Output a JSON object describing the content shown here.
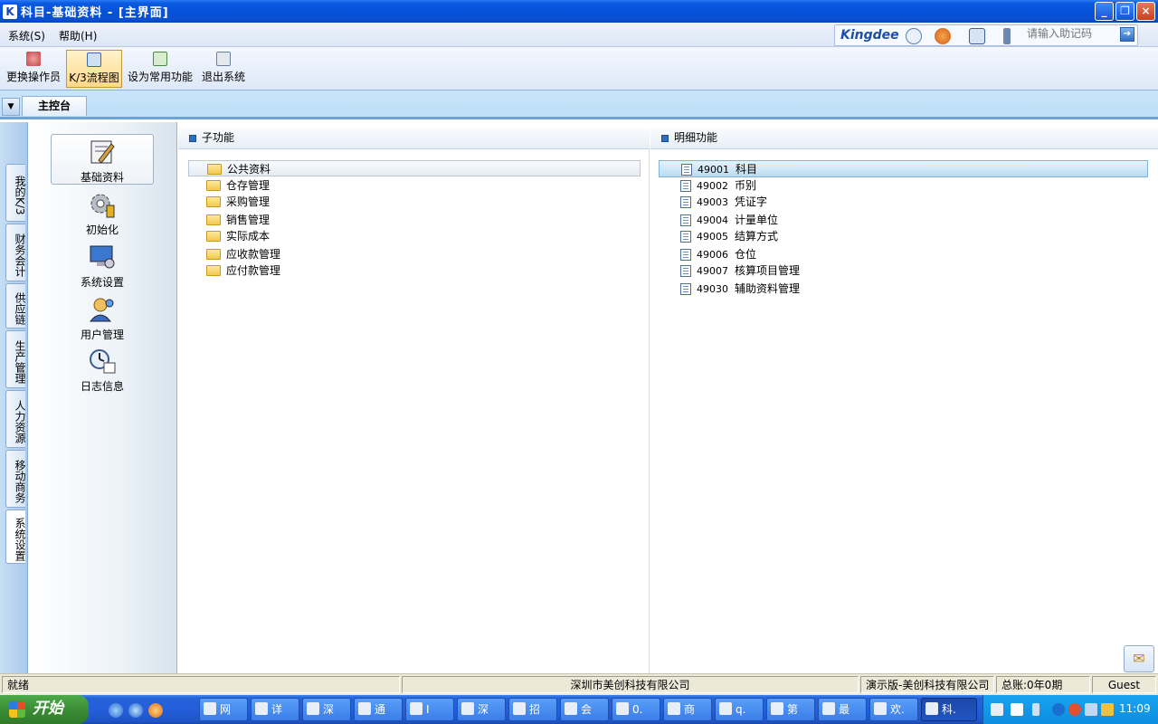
{
  "window": {
    "app_icon": "K",
    "title": "科目-基础资料 - [主界面]",
    "buttons": [
      "_",
      "❐",
      "×"
    ]
  },
  "menu": {
    "items": [
      "系统(S)",
      "帮助(H)"
    ],
    "brand": "Kingdee",
    "help_placeholder": "请输入助记码",
    "go_label": "➔"
  },
  "toolbar": {
    "buttons": [
      "更换操作员",
      "K/3流程图",
      "设为常用功能",
      "退出系统"
    ]
  },
  "tabs": {
    "dropdown": "▼",
    "main": "主控台"
  },
  "vertical_tabs": [
    "我的K/3",
    "财务会计",
    "供应链",
    "生产管理",
    "人力资源",
    "移动商务",
    "系统设置"
  ],
  "nav": {
    "items": [
      "基础资料",
      "初始化",
      "系统设置",
      "用户管理",
      "日志信息"
    ]
  },
  "sub_functions": {
    "header": "子功能",
    "items": [
      "公共资料",
      "仓存管理",
      "采购管理",
      "销售管理",
      "实际成本",
      "应收款管理",
      "应付款管理"
    ]
  },
  "details": {
    "header": "明细功能",
    "items": [
      {
        "code": "49001",
        "name": "科目"
      },
      {
        "code": "49002",
        "name": "币别"
      },
      {
        "code": "49003",
        "name": "凭证字"
      },
      {
        "code": "49004",
        "name": "计量单位"
      },
      {
        "code": "49005",
        "name": "结算方式"
      },
      {
        "code": "49006",
        "name": "仓位"
      },
      {
        "code": "49007",
        "name": "核算项目管理"
      },
      {
        "code": "49030",
        "name": "辅助资料管理"
      }
    ]
  },
  "message_icon": "✉",
  "status": {
    "state": "就绪",
    "company": "深圳市美创科技有限公司",
    "edition": "演示版-美创科技有限公司",
    "ledger": "总账:0年0期",
    "user": "Guest"
  },
  "taskbar": {
    "start": "开始",
    "buttons": [
      "网",
      "详",
      "深",
      "通",
      "I",
      "深",
      "招",
      "会",
      "0.",
      "商",
      "q.",
      "第",
      "最",
      "欢.",
      "科."
    ],
    "clock": "11:09"
  }
}
